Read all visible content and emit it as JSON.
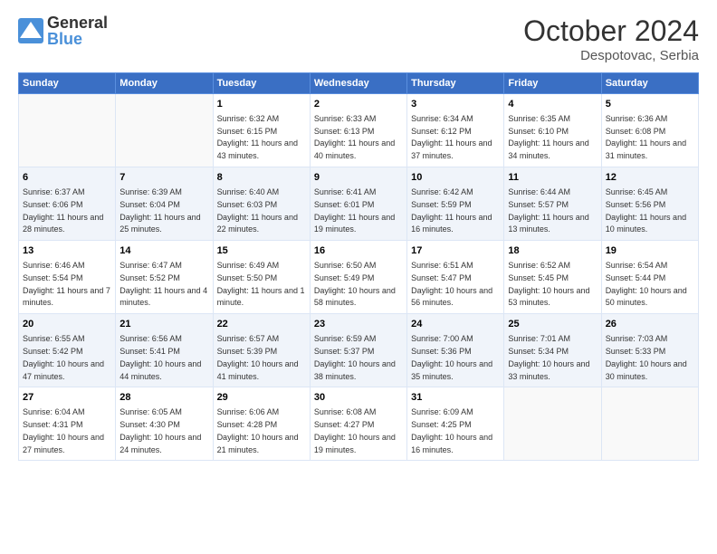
{
  "header": {
    "logo_general": "General",
    "logo_blue": "Blue",
    "month_title": "October 2024",
    "location": "Despotovac, Serbia"
  },
  "weekdays": [
    "Sunday",
    "Monday",
    "Tuesday",
    "Wednesday",
    "Thursday",
    "Friday",
    "Saturday"
  ],
  "weeks": [
    [
      {
        "day": "",
        "info": ""
      },
      {
        "day": "",
        "info": ""
      },
      {
        "day": "1",
        "info": "Sunrise: 6:32 AM\nSunset: 6:15 PM\nDaylight: 11 hours and 43 minutes."
      },
      {
        "day": "2",
        "info": "Sunrise: 6:33 AM\nSunset: 6:13 PM\nDaylight: 11 hours and 40 minutes."
      },
      {
        "day": "3",
        "info": "Sunrise: 6:34 AM\nSunset: 6:12 PM\nDaylight: 11 hours and 37 minutes."
      },
      {
        "day": "4",
        "info": "Sunrise: 6:35 AM\nSunset: 6:10 PM\nDaylight: 11 hours and 34 minutes."
      },
      {
        "day": "5",
        "info": "Sunrise: 6:36 AM\nSunset: 6:08 PM\nDaylight: 11 hours and 31 minutes."
      }
    ],
    [
      {
        "day": "6",
        "info": "Sunrise: 6:37 AM\nSunset: 6:06 PM\nDaylight: 11 hours and 28 minutes."
      },
      {
        "day": "7",
        "info": "Sunrise: 6:39 AM\nSunset: 6:04 PM\nDaylight: 11 hours and 25 minutes."
      },
      {
        "day": "8",
        "info": "Sunrise: 6:40 AM\nSunset: 6:03 PM\nDaylight: 11 hours and 22 minutes."
      },
      {
        "day": "9",
        "info": "Sunrise: 6:41 AM\nSunset: 6:01 PM\nDaylight: 11 hours and 19 minutes."
      },
      {
        "day": "10",
        "info": "Sunrise: 6:42 AM\nSunset: 5:59 PM\nDaylight: 11 hours and 16 minutes."
      },
      {
        "day": "11",
        "info": "Sunrise: 6:44 AM\nSunset: 5:57 PM\nDaylight: 11 hours and 13 minutes."
      },
      {
        "day": "12",
        "info": "Sunrise: 6:45 AM\nSunset: 5:56 PM\nDaylight: 11 hours and 10 minutes."
      }
    ],
    [
      {
        "day": "13",
        "info": "Sunrise: 6:46 AM\nSunset: 5:54 PM\nDaylight: 11 hours and 7 minutes."
      },
      {
        "day": "14",
        "info": "Sunrise: 6:47 AM\nSunset: 5:52 PM\nDaylight: 11 hours and 4 minutes."
      },
      {
        "day": "15",
        "info": "Sunrise: 6:49 AM\nSunset: 5:50 PM\nDaylight: 11 hours and 1 minute."
      },
      {
        "day": "16",
        "info": "Sunrise: 6:50 AM\nSunset: 5:49 PM\nDaylight: 10 hours and 58 minutes."
      },
      {
        "day": "17",
        "info": "Sunrise: 6:51 AM\nSunset: 5:47 PM\nDaylight: 10 hours and 56 minutes."
      },
      {
        "day": "18",
        "info": "Sunrise: 6:52 AM\nSunset: 5:45 PM\nDaylight: 10 hours and 53 minutes."
      },
      {
        "day": "19",
        "info": "Sunrise: 6:54 AM\nSunset: 5:44 PM\nDaylight: 10 hours and 50 minutes."
      }
    ],
    [
      {
        "day": "20",
        "info": "Sunrise: 6:55 AM\nSunset: 5:42 PM\nDaylight: 10 hours and 47 minutes."
      },
      {
        "day": "21",
        "info": "Sunrise: 6:56 AM\nSunset: 5:41 PM\nDaylight: 10 hours and 44 minutes."
      },
      {
        "day": "22",
        "info": "Sunrise: 6:57 AM\nSunset: 5:39 PM\nDaylight: 10 hours and 41 minutes."
      },
      {
        "day": "23",
        "info": "Sunrise: 6:59 AM\nSunset: 5:37 PM\nDaylight: 10 hours and 38 minutes."
      },
      {
        "day": "24",
        "info": "Sunrise: 7:00 AM\nSunset: 5:36 PM\nDaylight: 10 hours and 35 minutes."
      },
      {
        "day": "25",
        "info": "Sunrise: 7:01 AM\nSunset: 5:34 PM\nDaylight: 10 hours and 33 minutes."
      },
      {
        "day": "26",
        "info": "Sunrise: 7:03 AM\nSunset: 5:33 PM\nDaylight: 10 hours and 30 minutes."
      }
    ],
    [
      {
        "day": "27",
        "info": "Sunrise: 6:04 AM\nSunset: 4:31 PM\nDaylight: 10 hours and 27 minutes."
      },
      {
        "day": "28",
        "info": "Sunrise: 6:05 AM\nSunset: 4:30 PM\nDaylight: 10 hours and 24 minutes."
      },
      {
        "day": "29",
        "info": "Sunrise: 6:06 AM\nSunset: 4:28 PM\nDaylight: 10 hours and 21 minutes."
      },
      {
        "day": "30",
        "info": "Sunrise: 6:08 AM\nSunset: 4:27 PM\nDaylight: 10 hours and 19 minutes."
      },
      {
        "day": "31",
        "info": "Sunrise: 6:09 AM\nSunset: 4:25 PM\nDaylight: 10 hours and 16 minutes."
      },
      {
        "day": "",
        "info": ""
      },
      {
        "day": "",
        "info": ""
      }
    ]
  ]
}
